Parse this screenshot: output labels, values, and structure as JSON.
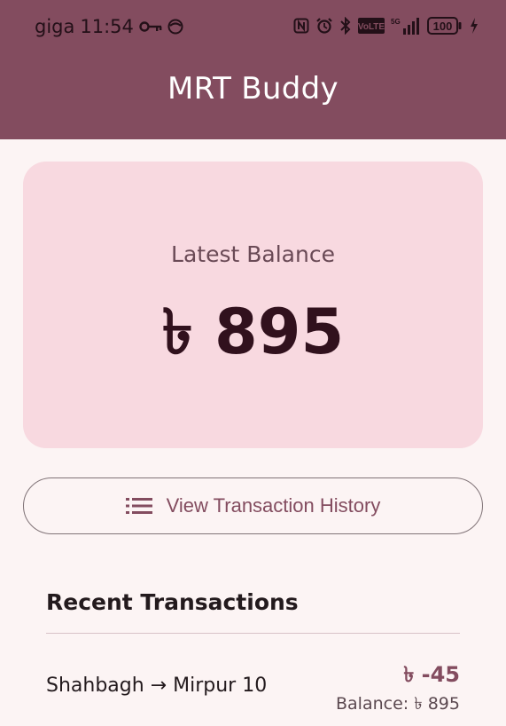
{
  "status_bar": {
    "carrier": "giga",
    "time": "11:54",
    "network": "5G",
    "volte": "VoLTE",
    "battery": "100"
  },
  "app_bar": {
    "title": "MRT Buddy"
  },
  "balance_card": {
    "label": "Latest Balance",
    "amount": "৳ 895"
  },
  "history_button": {
    "label": "View Transaction History"
  },
  "recent": {
    "title": "Recent Transactions",
    "items": [
      {
        "route": "Shahbagh → Mirpur 10",
        "amount": "৳ -45",
        "balance": "Balance: ৳ 895"
      }
    ]
  },
  "colors": {
    "primary": "#834c5f",
    "background": "#fcf4f4",
    "card": "#f8d9e0",
    "outline": "#807377"
  },
  "icons": [
    "key-icon",
    "face-icon",
    "nfc-icon",
    "alarm-icon",
    "bluetooth-icon",
    "volte-icon",
    "signal-icon",
    "battery-icon",
    "charging-icon",
    "list-icon"
  ]
}
